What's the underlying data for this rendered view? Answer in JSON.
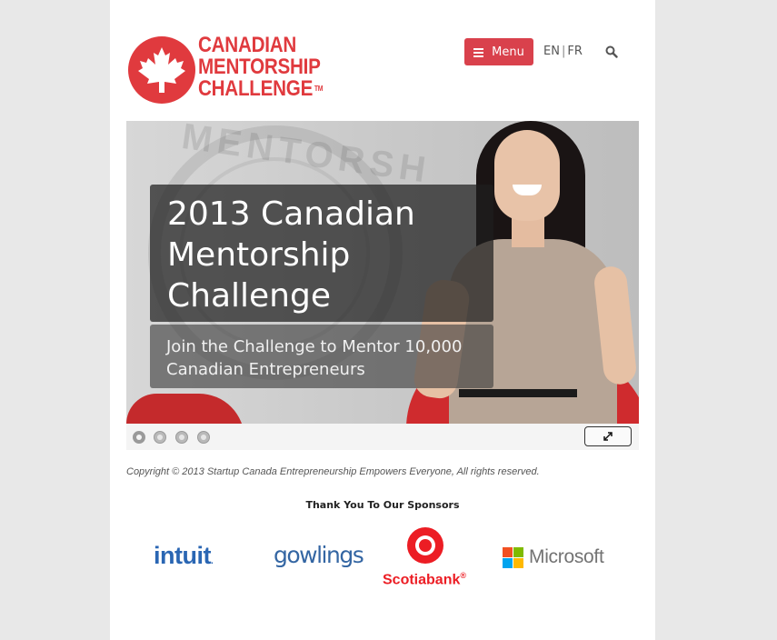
{
  "header": {
    "logo_lines": [
      "CANADIAN",
      "MENTORSHIP",
      "CHALLENGE"
    ],
    "logo_tm": "TM",
    "menu_label": "Menu",
    "lang_en": "EN",
    "lang_sep": "|",
    "lang_fr": "FR"
  },
  "hero": {
    "title": "2013 Canadian Mentorship Challenge",
    "subtitle": "Join the Challenge to Mentor 10,000 Canadian Entrepreneurs",
    "seal_text": "MENTORSH",
    "slide_count": 4,
    "active_slide": 1
  },
  "footer": {
    "copyright": "Copyright © 2013 Startup Canada Entrepreneurship Empowers Everyone, All rights reserved.",
    "sponsors_title": "Thank You To Our Sponsors"
  },
  "sponsors": {
    "intuit": "intuit",
    "intuit_mark": ".",
    "gowlings": "gowlings",
    "scotiabank": "Scotiabank",
    "scotiabank_mark": "®",
    "microsoft": "Microsoft"
  },
  "colors": {
    "brand_red": "#e03a3e",
    "menu_button": "#d9414c",
    "intuit_blue": "#2a66b3",
    "scotia_red": "#ec1d24"
  }
}
